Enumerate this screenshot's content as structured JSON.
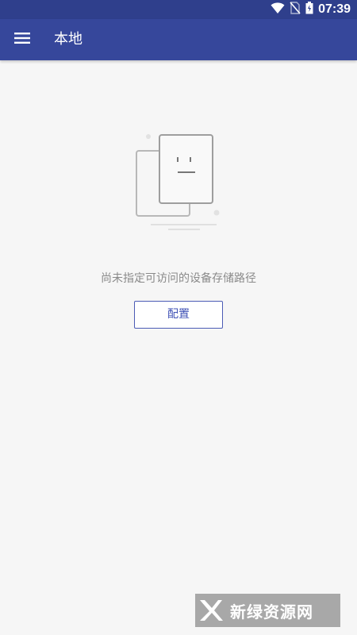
{
  "status_bar": {
    "time": "07:39",
    "icons": [
      "wifi-icon",
      "no-sim-icon",
      "battery-icon"
    ]
  },
  "app_bar": {
    "menu_icon": "menu-icon",
    "title": "本地"
  },
  "empty_state": {
    "illustration": "empty-documents-icon",
    "message": "尚未指定可访问的设备存储路径",
    "button_label": "配置"
  },
  "watermark": {
    "text": "新绿资源网"
  },
  "colors": {
    "status_bar": "#2f3f8c",
    "app_bar": "#36479b",
    "background": "#f6f6f6",
    "accent": "#3f51b5",
    "message_text": "#8a8a8a"
  }
}
